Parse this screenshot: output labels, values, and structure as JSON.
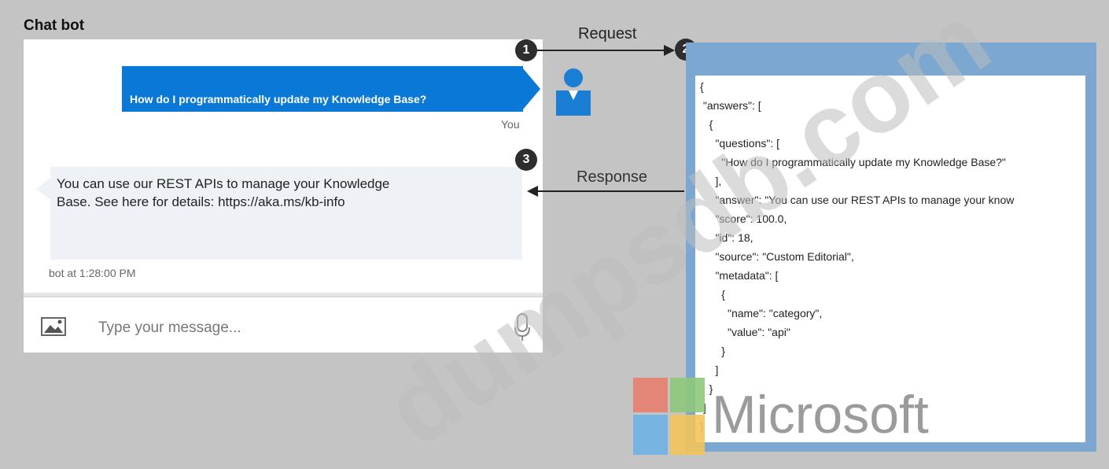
{
  "title": "Chat bot",
  "chat": {
    "user_message": "How do I programmatically update my Knowledge Base?",
    "user_label": "You",
    "bot_message_line1": "You can use our REST APIs to manage your Knowledge",
    "bot_message_line2": "Base. See here for details: https://aka.ms/kb-info",
    "bot_timestamp": "bot at 1:28:00 PM",
    "input_placeholder": "Type your message..."
  },
  "flow": {
    "marker1": "1",
    "marker2": "2",
    "marker3": "3",
    "request_label": "Request",
    "response_label": "Response"
  },
  "json_lines": [
    "{",
    " \"answers\": [",
    "   {",
    "     \"questions\": [",
    "       \"How do I programmatically update my Knowledge Base?\"",
    "     ],",
    "     \"answer\": \"You can use our REST APIs to manage your know",
    "     \"score\": 100.0,",
    "     \"id\": 18,",
    "     \"source\": \"Custom Editorial\",",
    "     \"metadata\": [",
    "       {",
    "         \"name\": \"category\",",
    "         \"value\": \"api\"",
    "       }",
    "     ]",
    "   }",
    " ]",
    "}"
  ],
  "branding": {
    "logo_text": "Microsoft",
    "watermark": "dumpsdb.com"
  },
  "colors": {
    "user_bubble": "#0a78d7",
    "panel_border": "#7ba7d0",
    "background": "#c4c4c4"
  }
}
